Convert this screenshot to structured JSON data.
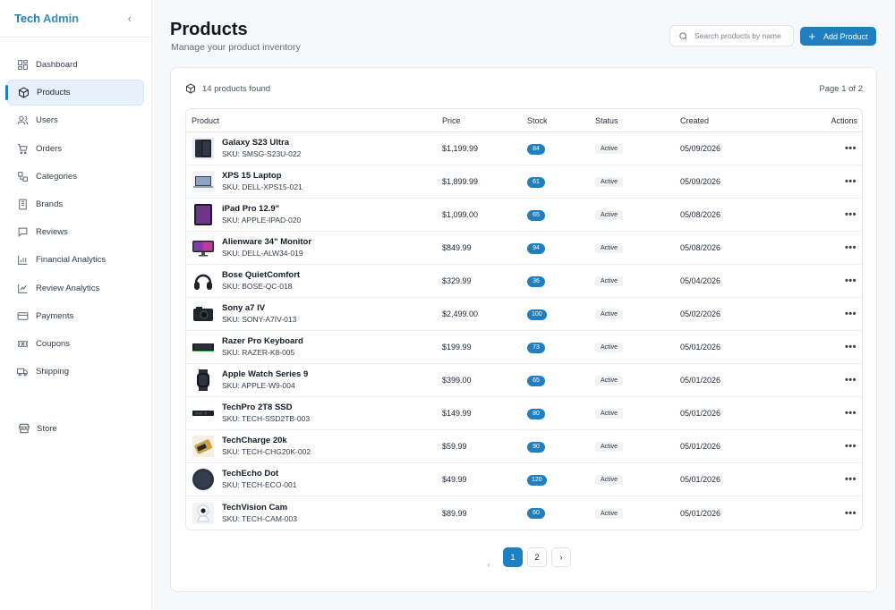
{
  "sidebar": {
    "brand_part1": "Tech",
    "brand_part2": "Admin",
    "collapse_glyph": "‹",
    "items": [
      {
        "label": "Dashboard",
        "icon": "dashboard-icon"
      },
      {
        "label": "Products",
        "icon": "box-icon",
        "active": true
      },
      {
        "label": "Users",
        "icon": "users-icon"
      },
      {
        "label": "Orders",
        "icon": "cart-icon"
      },
      {
        "label": "Categories",
        "icon": "categories-icon"
      },
      {
        "label": "Brands",
        "icon": "brands-icon"
      },
      {
        "label": "Reviews",
        "icon": "reviews-icon"
      },
      {
        "label": "Financial Analytics",
        "icon": "bar-chart-icon"
      },
      {
        "label": "Review Analytics",
        "icon": "line-chart-icon"
      },
      {
        "label": "Payments",
        "icon": "credit-card-icon"
      },
      {
        "label": "Coupons",
        "icon": "ticket-icon"
      },
      {
        "label": "Shipping",
        "icon": "truck-icon"
      }
    ],
    "store_label": "Store"
  },
  "header": {
    "title": "Products",
    "subtitle": "Manage your product inventory",
    "search_placeholder": "Search products by name",
    "add_label": "Add Product"
  },
  "summary": {
    "count_text": "14 products found",
    "page_info": "Page 1 of 2"
  },
  "table": {
    "columns": [
      "Product",
      "Price",
      "Stock",
      "Status",
      "Created",
      "Actions"
    ],
    "rows": [
      {
        "name": "Galaxy S23 Ultra",
        "sku": "SKU: SMSG-S23U-022",
        "price": "$1,199.99",
        "stock": "84",
        "status": "Active",
        "created": "05/09/2026",
        "actions": "•••",
        "thumb": "phone"
      },
      {
        "name": "XPS 15 Laptop",
        "sku": "SKU: DELL-XPS15-021",
        "price": "$1,899.99",
        "stock": "61",
        "status": "Active",
        "created": "05/09/2026",
        "actions": "•••",
        "thumb": "laptop"
      },
      {
        "name": "iPad Pro 12.9\"",
        "sku": "SKU: APPLE-IPAD-020",
        "price": "$1,099.00",
        "stock": "65",
        "status": "Active",
        "created": "05/08/2026",
        "actions": "•••",
        "thumb": "tablet"
      },
      {
        "name": "Alienware 34\" Monitor",
        "sku": "SKU: DELL-ALW34-019",
        "price": "$849.99",
        "stock": "94",
        "status": "Active",
        "created": "05/08/2026",
        "actions": "•••",
        "thumb": "monitor"
      },
      {
        "name": "Bose QuietComfort",
        "sku": "SKU: BOSE-QC-018",
        "price": "$329.99",
        "stock": "36",
        "status": "Active",
        "created": "05/04/2026",
        "actions": "•••",
        "thumb": "headphones"
      },
      {
        "name": "Sony a7 IV",
        "sku": "SKU: SONY-A7IV-013",
        "price": "$2,499.00",
        "stock": "100",
        "status": "Active",
        "created": "05/02/2026",
        "actions": "•••",
        "thumb": "camera"
      },
      {
        "name": "Razer Pro Keyboard",
        "sku": "SKU: RAZER-K8-005",
        "price": "$199.99",
        "stock": "73",
        "status": "Active",
        "created": "05/01/2026",
        "actions": "•••",
        "thumb": "keyboard"
      },
      {
        "name": "Apple Watch Series 9",
        "sku": "SKU: APPLE-W9-004",
        "price": "$399.00",
        "stock": "65",
        "status": "Active",
        "created": "05/01/2026",
        "actions": "•••",
        "thumb": "watch"
      },
      {
        "name": "TechPro 2T8 SSD",
        "sku": "SKU: TECH-SSD2TB-003",
        "price": "$149.99",
        "stock": "80",
        "status": "Active",
        "created": "05/01/2026",
        "actions": "•••",
        "thumb": "ssd"
      },
      {
        "name": "TechCharge 20k",
        "sku": "SKU: TECH-CHG20K-002",
        "price": "$59.99",
        "stock": "90",
        "status": "Active",
        "created": "05/01/2026",
        "actions": "•••",
        "thumb": "powerbank"
      },
      {
        "name": "TechEcho Dot",
        "sku": "SKU: TECH-ECO-001",
        "price": "$49.99",
        "stock": "120",
        "status": "Active",
        "created": "05/01/2026",
        "actions": "•••",
        "thumb": "speaker"
      },
      {
        "name": "TechVision Cam",
        "sku": "SKU: TECH-CAM-003",
        "price": "$89.99",
        "stock": "60",
        "status": "Active",
        "created": "05/01/2026",
        "actions": "•••",
        "thumb": "securitycam"
      }
    ]
  },
  "pagination": {
    "prev": "‹",
    "pages": [
      "1",
      "2"
    ],
    "current": "1",
    "next": "›"
  },
  "colors": {
    "accent": "#1f7fc0",
    "active_bg": "#e8f0fb"
  }
}
